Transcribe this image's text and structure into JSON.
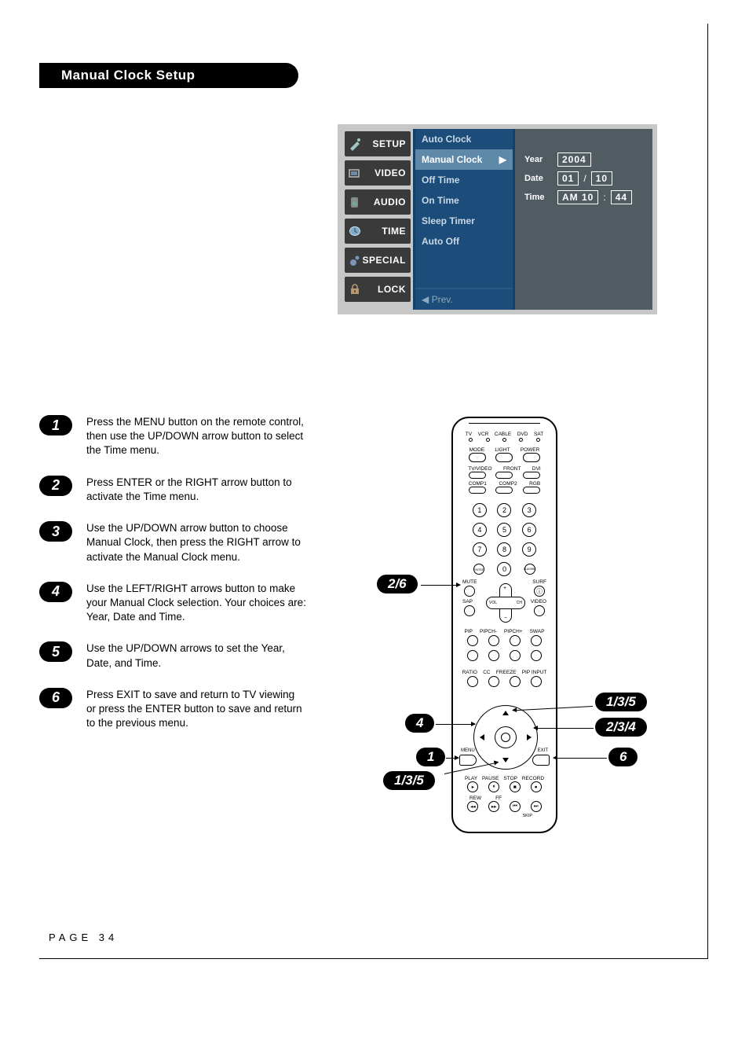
{
  "title": "Manual Clock Setup",
  "page_label": "PAGE 34",
  "osd": {
    "tabs": [
      "SETUP",
      "VIDEO",
      "AUDIO",
      "TIME",
      "SPECIAL",
      "LOCK"
    ],
    "menu": {
      "items": [
        "Auto Clock",
        "Manual Clock",
        "Off Time",
        "On Time",
        "Sleep Timer",
        "Auto Off"
      ],
      "selected_index": 1,
      "prev_label": "◀ Prev."
    },
    "fields": {
      "year_label": "Year",
      "year_value": "2004",
      "date_label": "Date",
      "date_month": "01",
      "date_sep": "/",
      "date_day": "10",
      "time_label": "Time",
      "time_ampm_hour": "AM 10",
      "time_sep": ":",
      "time_min": "44"
    }
  },
  "steps": [
    {
      "n": "1",
      "text": "Press the MENU button on the remote control, then use the UP/DOWN arrow button to select the Time menu."
    },
    {
      "n": "2",
      "text": "Press ENTER or the RIGHT arrow button to activate the Time menu."
    },
    {
      "n": "3",
      "text": "Use the UP/DOWN arrow button to choose Manual Clock, then press the RIGHT arrow to activate the Manual Clock menu."
    },
    {
      "n": "4",
      "text": "Use the LEFT/RIGHT arrows button to make your Manual Clock selection. Your choices are: Year, Date and Time."
    },
    {
      "n": "5",
      "text": "Use the UP/DOWN arrows to set the Year, Date, and Time."
    },
    {
      "n": "6",
      "text": "Press EXIT to save and return to TV viewing or press the ENTER button to save and return to the previous menu."
    }
  ],
  "remote": {
    "indicators": [
      "TV",
      "VCR",
      "CABLE",
      "DVD",
      "SAT"
    ],
    "row1_labels": [
      "MODE",
      "LIGHT",
      "POWER"
    ],
    "row2_labels": [
      "TV/VIDEO",
      "FRONT",
      "DVI"
    ],
    "row3_labels": [
      "COMP1",
      "COMP2",
      "RGB"
    ],
    "numpad": [
      [
        "1",
        "2",
        "3"
      ],
      [
        "4",
        "5",
        "6"
      ],
      [
        "7",
        "8",
        "9"
      ]
    ],
    "row_zero": {
      "left": "ENTER",
      "mid": "0",
      "right": "FLASHBK"
    },
    "row_mute": {
      "left": "MUTE",
      "right": "SURF"
    },
    "row_sap": {
      "left": "SAP",
      "right": "VIDEO"
    },
    "cross": {
      "vol": "VOL",
      "ch": "CH"
    },
    "row_pip": [
      "PIP",
      "PIPCH-",
      "PIPCH+",
      "SWAP"
    ],
    "row_ratio": [
      "RATIO",
      "CC",
      "FREEZE",
      "PIP INPUT"
    ],
    "menu_label": "MENU",
    "exit_label": "EXIT",
    "play_row": [
      "PLAY",
      "PAUSE",
      "STOP",
      "RECORD"
    ],
    "rew_row": [
      "REW",
      "FF",
      "",
      ""
    ],
    "skip_label": "SKIP"
  },
  "callouts": {
    "c_2_6": "2/6",
    "c_4": "4",
    "c_1": "1",
    "c_1_3_5_left": "1/3/5",
    "c_1_3_5_right": "1/3/5",
    "c_2_3_4": "2/3/4",
    "c_6": "6"
  }
}
